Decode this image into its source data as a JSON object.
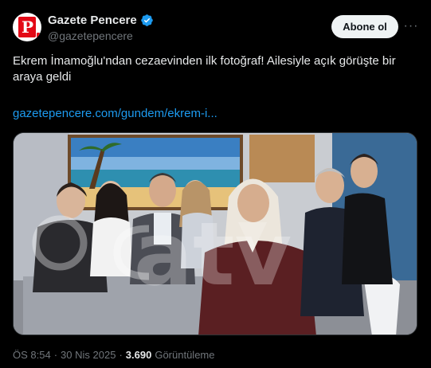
{
  "account": {
    "display_name": "Gazete Pencere",
    "handle": "@gazetepencere",
    "avatar_letter": "P",
    "verified": true,
    "avatar_icon": "gazete-pencere-logo",
    "verified_icon": "verified-badge-icon"
  },
  "actions": {
    "follow_label": "Abone ol",
    "more_icon": "more-dots-icon",
    "more_label": "···"
  },
  "tweet": {
    "text": "Ekrem İmamoğlu'ndan cezaevinden ilk fotoğraf! Ailesiyle açık görüşte bir araya geldi",
    "link_text": "gazetepencere.com/gundem/ekrem-i..."
  },
  "media": {
    "watermark": "atv"
  },
  "meta": {
    "time": "ÖS 8:54",
    "separator": "·",
    "date": "30 Nis 2025",
    "views_count": "3.690",
    "views_label": "Görüntüleme"
  },
  "colors": {
    "background": "#000000",
    "text_primary": "#e7e9ea",
    "text_secondary": "#71767b",
    "link": "#1d9bf0",
    "verified": "#1d9bf0",
    "follow_bg": "#eff3f4",
    "brand_red": "#e30a17"
  }
}
